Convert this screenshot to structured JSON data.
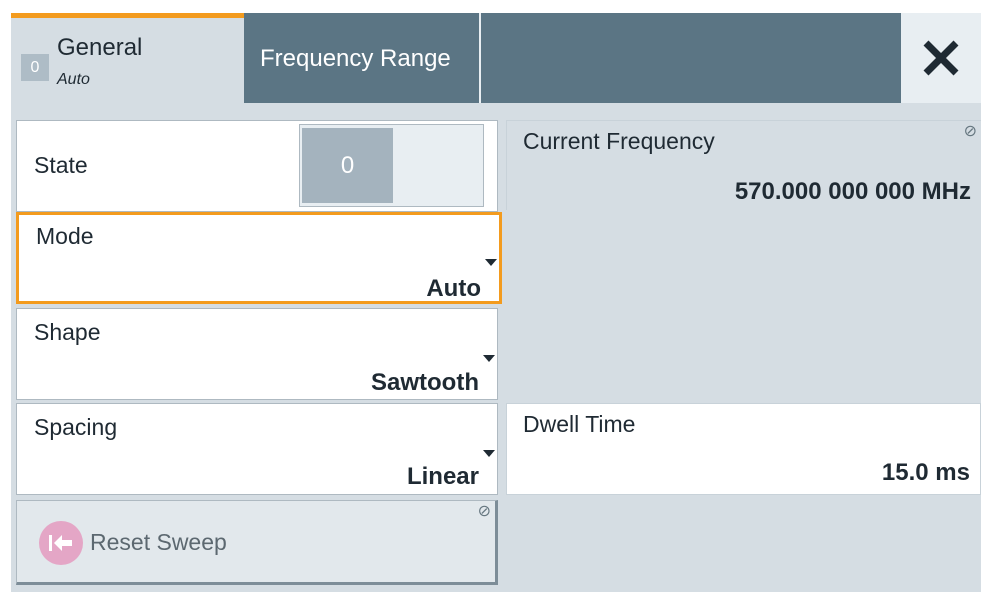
{
  "tabs": {
    "general": {
      "label": "General",
      "sub": "Auto",
      "state": "0"
    },
    "frequency_range": {
      "label": "Frequency Range"
    }
  },
  "state": {
    "label": "State",
    "value": "0"
  },
  "current_frequency": {
    "label": "Current Frequency",
    "value": "570.000 000 000 MHz"
  },
  "mode": {
    "label": "Mode",
    "value": "Auto"
  },
  "shape": {
    "label": "Shape",
    "value": "Sawtooth"
  },
  "spacing": {
    "label": "Spacing",
    "value": "Linear"
  },
  "dwell_time": {
    "label": "Dwell Time",
    "value": "15.0 ms"
  },
  "reset_sweep": {
    "label": "Reset Sweep"
  },
  "icons": {
    "close": "close-icon",
    "reset": "reset-arrow-icon",
    "readonly": "read-only-icon"
  },
  "colors": {
    "accent": "#f39b1e",
    "tab_bar": "#5b7584",
    "background": "#d5dde3"
  }
}
